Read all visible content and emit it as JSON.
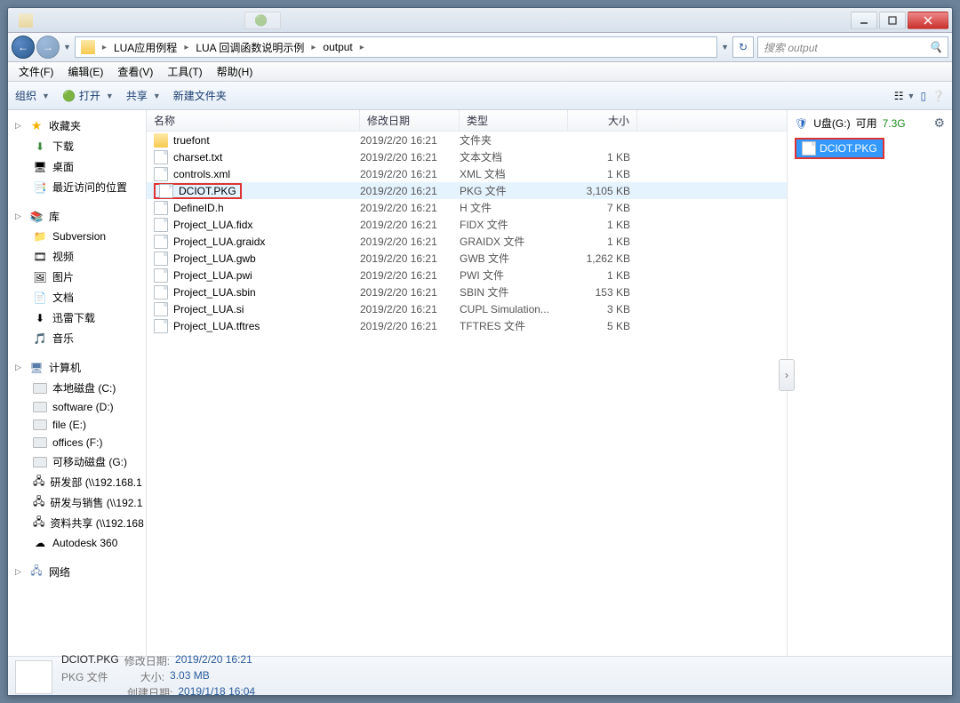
{
  "titlebar": {
    "tab_text": "",
    "app_text": ""
  },
  "breadcrumbs": [
    "LUA应用例程",
    "LUA 回调函数说明示例",
    "output"
  ],
  "search": {
    "placeholder": "搜索 output"
  },
  "menus": [
    "文件(F)",
    "编辑(E)",
    "查看(V)",
    "工具(T)",
    "帮助(H)"
  ],
  "commands": {
    "organize": "组织",
    "open": "打开",
    "share": "共享",
    "newfolder": "新建文件夹"
  },
  "nav": {
    "favorites": {
      "label": "收藏夹",
      "items": [
        "下载",
        "桌面",
        "最近访问的位置"
      ]
    },
    "libraries": {
      "label": "库",
      "items": [
        "Subversion",
        "视频",
        "图片",
        "文档",
        "迅雷下载",
        "音乐"
      ]
    },
    "computer": {
      "label": "计算机",
      "items": [
        "本地磁盘 (C:)",
        "software (D:)",
        "file (E:)",
        "offices (F:)",
        "可移动磁盘 (G:)",
        "研发部 (\\\\192.168.1",
        "研发与销售 (\\\\192.1",
        "资料共享 (\\\\192.168",
        "Autodesk 360"
      ]
    },
    "network": {
      "label": "网络"
    }
  },
  "columns": {
    "name": "名称",
    "date": "修改日期",
    "type": "类型",
    "size": "大小"
  },
  "files": [
    {
      "name": "truefont",
      "date": "2019/2/20 16:21",
      "type": "文件夹",
      "size": "",
      "icon": "folder"
    },
    {
      "name": "charset.txt",
      "date": "2019/2/20 16:21",
      "type": "文本文档",
      "size": "1 KB",
      "icon": "file"
    },
    {
      "name": "controls.xml",
      "date": "2019/2/20 16:21",
      "type": "XML 文档",
      "size": "1 KB",
      "icon": "file"
    },
    {
      "name": "DCIOT.PKG",
      "date": "2019/2/20 16:21",
      "type": "PKG 文件",
      "size": "3,105 KB",
      "icon": "file",
      "selected": true,
      "boxed": true
    },
    {
      "name": "DefineID.h",
      "date": "2019/2/20 16:21",
      "type": "H 文件",
      "size": "7 KB",
      "icon": "file"
    },
    {
      "name": "Project_LUA.fidx",
      "date": "2019/2/20 16:21",
      "type": "FIDX 文件",
      "size": "1 KB",
      "icon": "file"
    },
    {
      "name": "Project_LUA.graidx",
      "date": "2019/2/20 16:21",
      "type": "GRAIDX 文件",
      "size": "1 KB",
      "icon": "file"
    },
    {
      "name": "Project_LUA.gwb",
      "date": "2019/2/20 16:21",
      "type": "GWB 文件",
      "size": "1,262 KB",
      "icon": "file"
    },
    {
      "name": "Project_LUA.pwi",
      "date": "2019/2/20 16:21",
      "type": "PWI 文件",
      "size": "1 KB",
      "icon": "file"
    },
    {
      "name": "Project_LUA.sbin",
      "date": "2019/2/20 16:21",
      "type": "SBIN 文件",
      "size": "153 KB",
      "icon": "file"
    },
    {
      "name": "Project_LUA.si",
      "date": "2019/2/20 16:21",
      "type": "CUPL Simulation...",
      "size": "3 KB",
      "icon": "file"
    },
    {
      "name": "Project_LUA.tftres",
      "date": "2019/2/20 16:21",
      "type": "TFTRES 文件",
      "size": "5 KB",
      "icon": "file"
    }
  ],
  "sidepanel": {
    "drive": "U盘(G:)",
    "available_label": "可用",
    "available": "7.3G",
    "file": "DCIOT.PKG"
  },
  "details": {
    "name": "DCIOT.PKG",
    "type": "PKG 文件",
    "modified_label": "修改日期:",
    "modified": "2019/2/20 16:21",
    "size_label": "大小:",
    "size": "3.03 MB",
    "created_label": "创建日期:",
    "created": "2019/1/18 16:04"
  }
}
